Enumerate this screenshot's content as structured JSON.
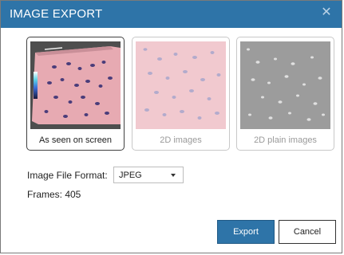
{
  "window": {
    "title": "IMAGE EXPORT",
    "close_glyph": "✕"
  },
  "options": [
    {
      "label": "As seen on screen",
      "selected": true
    },
    {
      "label": "2D images",
      "selected": false
    },
    {
      "label": "2D plain images",
      "selected": false
    }
  ],
  "file_format": {
    "label": "Image File Format:",
    "value": "JPEG"
  },
  "frames": {
    "text": "Frames: 405"
  },
  "buttons": {
    "export": "Export",
    "cancel": "Cancel"
  },
  "colors": {
    "titlebar": "#2e74a8",
    "export_button": "#2e74a8"
  }
}
